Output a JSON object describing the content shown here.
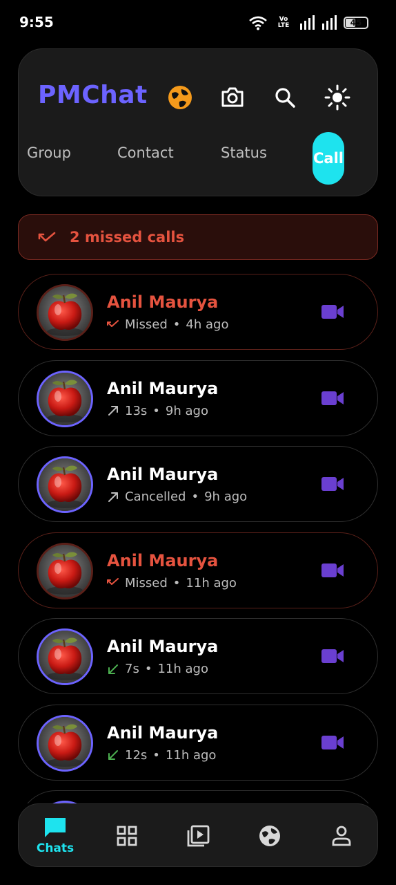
{
  "status_bar": {
    "time": "9:55",
    "volte": "Vo LTE",
    "battery": "45",
    "icons": [
      "wifi-icon",
      "volte-icon",
      "signal-icon",
      "signal-icon",
      "battery-icon"
    ]
  },
  "header": {
    "title": "PMChat",
    "icons": [
      "globe-icon",
      "camera-icon",
      "search-icon",
      "theme-sun-icon"
    ],
    "tabs": [
      {
        "label": "Group",
        "active": false
      },
      {
        "label": "Contact",
        "active": false
      },
      {
        "label": "Status",
        "active": false
      },
      {
        "label": "Call",
        "active": true
      }
    ]
  },
  "missed_banner": {
    "text": "2 missed calls"
  },
  "calls": [
    {
      "name": "Anil Maurya",
      "status": "Missed",
      "time": "4h ago",
      "type": "missed"
    },
    {
      "name": "Anil Maurya",
      "status": "13s",
      "time": "9h ago",
      "type": "outgoing"
    },
    {
      "name": "Anil Maurya",
      "status": "Cancelled",
      "time": "9h ago",
      "type": "outgoing"
    },
    {
      "name": "Anil Maurya",
      "status": "Missed",
      "time": "11h ago",
      "type": "missed"
    },
    {
      "name": "Anil Maurya",
      "status": "7s",
      "time": "11h ago",
      "type": "incoming"
    },
    {
      "name": "Anil Maurya",
      "status": "12s",
      "time": "11h ago",
      "type": "incoming"
    }
  ],
  "bottom_nav": {
    "items": [
      {
        "label": "Chats",
        "icon": "chat-icon",
        "active": true
      },
      {
        "label": "",
        "icon": "apps-grid-icon",
        "active": false
      },
      {
        "label": "",
        "icon": "video-library-icon",
        "active": false
      },
      {
        "label": "",
        "icon": "globe-icon",
        "active": false
      },
      {
        "label": "",
        "icon": "profile-icon",
        "active": false
      }
    ]
  },
  "colors": {
    "accent": "#6c63ff",
    "cyan": "#1ee3ee",
    "missed": "#e5533f",
    "incoming": "#4caf50",
    "video": "#6a3fd0",
    "globe": "#f59a1b"
  }
}
